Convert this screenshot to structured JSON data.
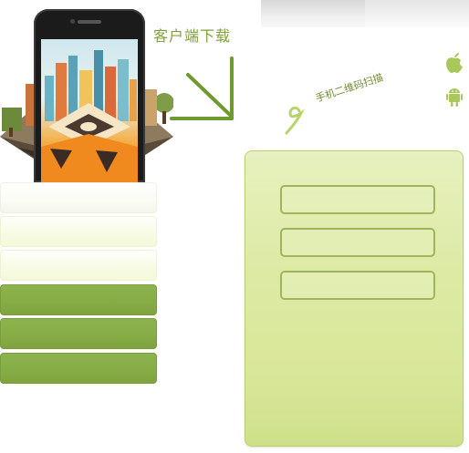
{
  "download": {
    "label": "客户端下载"
  },
  "scan": {
    "label": "手机二维码扫描"
  },
  "platforms": {
    "apple_icon": "apple-icon",
    "android_icon": "android-icon"
  },
  "menu": {
    "items": [
      {
        "style": "light-top",
        "label": ""
      },
      {
        "style": "light",
        "label": ""
      },
      {
        "style": "light",
        "label": ""
      },
      {
        "style": "green",
        "label": ""
      },
      {
        "style": "green",
        "label": ""
      },
      {
        "style": "green",
        "label": ""
      }
    ]
  },
  "form": {
    "fields": [
      {
        "value": "",
        "placeholder": ""
      },
      {
        "value": "",
        "placeholder": ""
      },
      {
        "value": "",
        "placeholder": ""
      }
    ]
  },
  "colors": {
    "accent_green": "#7fa23b",
    "menu_green": "#86ac46",
    "panel_green": "#dde9a6",
    "field_border": "#9eb65a",
    "icon_green": "#a7c95a"
  }
}
